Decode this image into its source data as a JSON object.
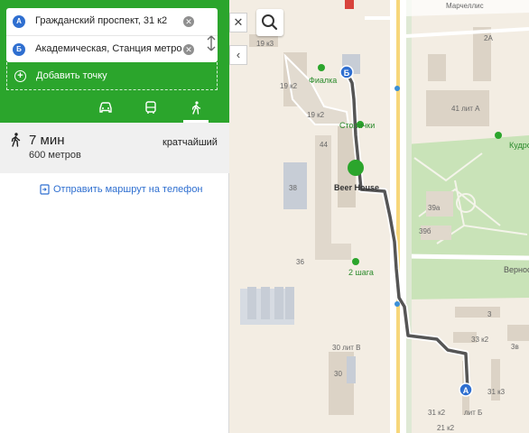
{
  "route_form": {
    "point_a": {
      "marker": "А",
      "value": "Гражданский проспект, 31 к2"
    },
    "point_b": {
      "marker": "Б",
      "value": "Академическая, Станция метро"
    },
    "add_point_label": "Добавить точку"
  },
  "transport_modes": [
    "car",
    "bus",
    "walk"
  ],
  "active_mode": "walk",
  "result": {
    "time": "7 мин",
    "distance": "600 метров",
    "type": "кратчайший"
  },
  "send_route_label": "Отправить маршрут на телефон",
  "map": {
    "labels": {
      "marshellis": "Марчеллис",
      "b19k3": "19 к3",
      "b19k2a": "19 к2",
      "b19k2b": "19 к2",
      "fialka": "Фиалка",
      "stolichki": "Столички",
      "b44": "44",
      "b38": "38",
      "beer_house": "Beer House",
      "b36": "36",
      "two_steps": "2 шага",
      "b41a": "41 лит А",
      "b39a": "39а",
      "b39b": "39б",
      "vernost": "Верност",
      "kudr": "Кудро",
      "b3": "3",
      "b33k2": "33 к2",
      "b30v": "30 лит В",
      "b31k3": "31 к3",
      "b31k2": "31 к2",
      "b2a": "2А",
      "b30": "30",
      "b21k2": "21 к2",
      "b31litb": "лит Б",
      "b3v": "3в"
    },
    "marker_a": "А",
    "marker_b": "Б"
  },
  "colors": {
    "accent_green": "#2ba52c",
    "route": "#555555",
    "marker_blue": "#2f6fd0",
    "link_blue": "#2f6fd0"
  }
}
